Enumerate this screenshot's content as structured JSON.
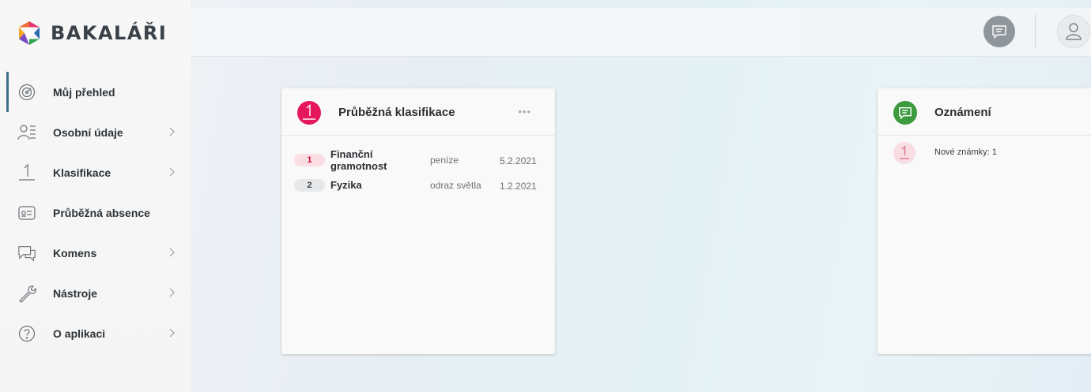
{
  "app": {
    "name": "BAKALÁŘI",
    "brand_colors": [
      "#e6356d",
      "#f5a623",
      "#2da44e",
      "#2b6cb0",
      "#7b4bc4"
    ]
  },
  "sidebar": {
    "items": [
      {
        "label": "Můj přehled",
        "icon": "dashboard-gauge-icon",
        "active": true,
        "has_submenu": false
      },
      {
        "label": "Osobní údaje",
        "icon": "personal-data-icon",
        "active": false,
        "has_submenu": true
      },
      {
        "label": "Klasifikace",
        "icon": "grade-one-icon",
        "active": false,
        "has_submenu": true
      },
      {
        "label": "Průběžná absence",
        "icon": "absence-card-icon",
        "active": false,
        "has_submenu": false
      },
      {
        "label": "Komens",
        "icon": "chat-bubbles-icon",
        "active": false,
        "has_submenu": true
      },
      {
        "label": "Nástroje",
        "icon": "wrench-icon",
        "active": false,
        "has_submenu": true
      },
      {
        "label": "O aplikaci",
        "icon": "question-icon",
        "active": false,
        "has_submenu": true
      }
    ]
  },
  "topbar": {
    "message_icon": "message-icon",
    "user_icon": "user-icon"
  },
  "cards": {
    "grades": {
      "badge": "1",
      "title": "Průběžná klasifikace",
      "more": "•••",
      "accent": "#e5175f",
      "rows": [
        {
          "grade": "1",
          "subject": "Finanční gramotnost",
          "topic": "peníze",
          "date": "5.2.2021",
          "pill_bg": "#fbdde4",
          "pill_fg": "#c8102e"
        },
        {
          "grade": "2",
          "subject": "Fyzika",
          "topic": "odraz světla",
          "date": "1.2.2021",
          "pill_bg": "#e6e8ea",
          "pill_fg": "#3a3f44"
        }
      ]
    },
    "notices": {
      "title": "Oznámení",
      "accent": "#3c9a3f",
      "rows": [
        {
          "badge": "1",
          "text": "Nové známky: 1"
        }
      ]
    }
  }
}
